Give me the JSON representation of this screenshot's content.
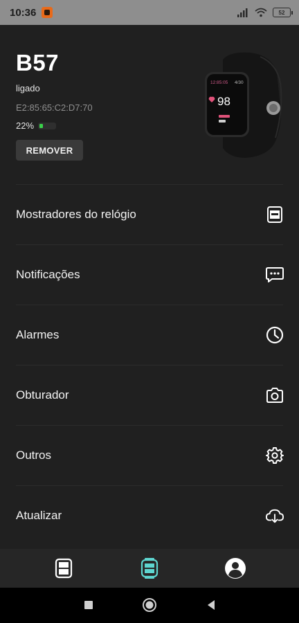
{
  "status_bar": {
    "time": "10:36",
    "battery": "52"
  },
  "device": {
    "name": "B57",
    "status": "ligado",
    "mac": "E2:85:65:C2:D7:70",
    "battery_percent": "22%",
    "battery_level": 0.22,
    "remove_label": "REMOVER",
    "watch_display": {
      "time": "12:85:05",
      "date": "4/30",
      "heart_rate": "98"
    }
  },
  "menu": {
    "items": [
      {
        "label": "Mostradores do relógio",
        "icon": "watch-face-icon"
      },
      {
        "label": "Notificações",
        "icon": "message-icon"
      },
      {
        "label": "Alarmes",
        "icon": "clock-icon"
      },
      {
        "label": "Obturador",
        "icon": "camera-icon"
      },
      {
        "label": "Outros",
        "icon": "gear-icon"
      },
      {
        "label": "Atualizar",
        "icon": "cloud-download-icon"
      }
    ]
  },
  "tabs": [
    {
      "icon": "device-list-icon",
      "active": false
    },
    {
      "icon": "watch-icon",
      "active": true
    },
    {
      "icon": "profile-icon",
      "active": false
    }
  ],
  "colors": {
    "background": "#202020",
    "accent": "#5ed6d0",
    "battery_green": "#3ad14a"
  }
}
